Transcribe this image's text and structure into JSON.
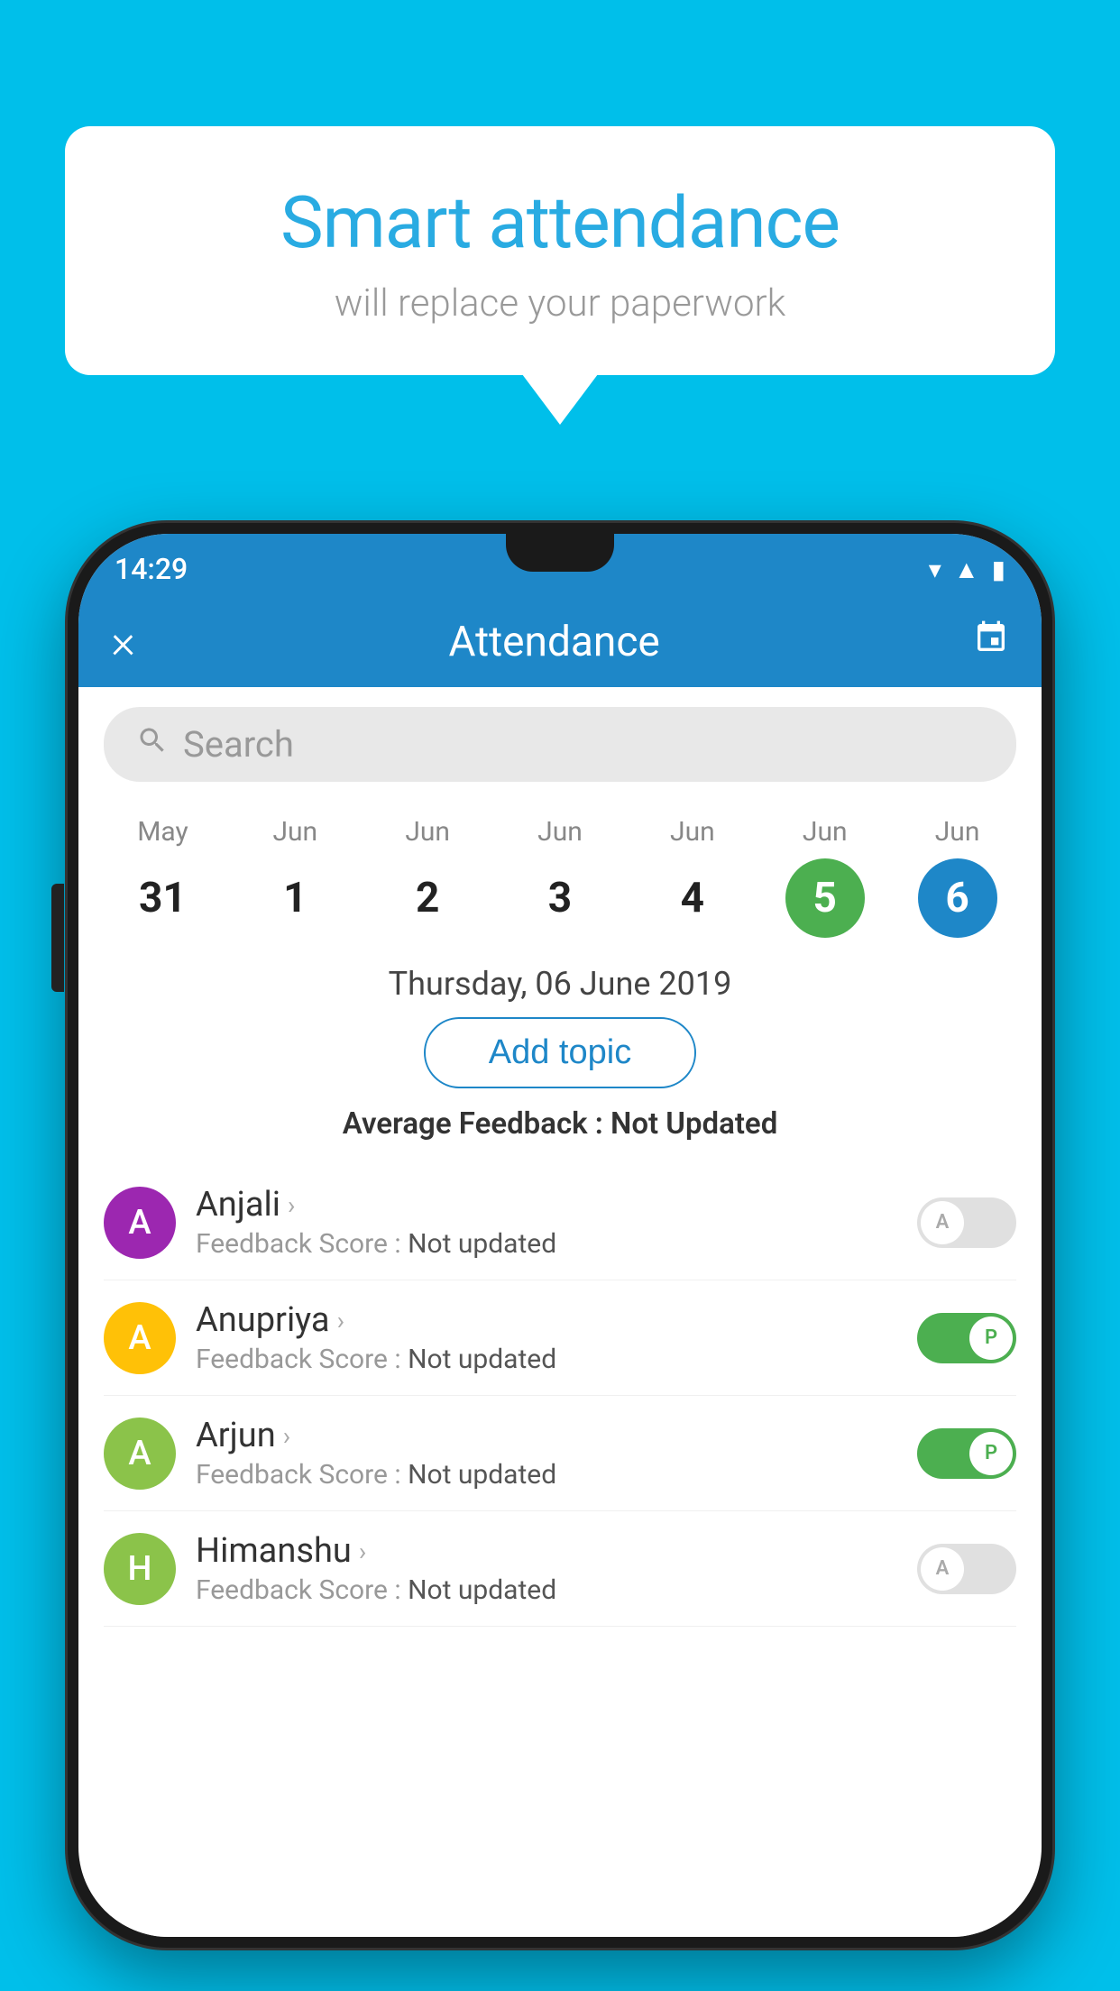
{
  "background_color": "#00BFEA",
  "bubble": {
    "title": "Smart attendance",
    "subtitle": "will replace your paperwork"
  },
  "status_bar": {
    "time": "14:29",
    "wifi": "▼",
    "signal": "▲",
    "battery": "▉"
  },
  "header": {
    "title": "Attendance",
    "close_icon": "×",
    "calendar_icon": "📅"
  },
  "search": {
    "placeholder": "Search"
  },
  "calendar": {
    "days": [
      {
        "month": "May",
        "num": "31",
        "state": "normal"
      },
      {
        "month": "Jun",
        "num": "1",
        "state": "normal"
      },
      {
        "month": "Jun",
        "num": "2",
        "state": "normal"
      },
      {
        "month": "Jun",
        "num": "3",
        "state": "normal"
      },
      {
        "month": "Jun",
        "num": "4",
        "state": "normal"
      },
      {
        "month": "Jun",
        "num": "5",
        "state": "today"
      },
      {
        "month": "Jun",
        "num": "6",
        "state": "selected"
      }
    ],
    "selected_date": "Thursday, 06 June 2019"
  },
  "add_topic_label": "Add topic",
  "avg_feedback": {
    "label": "Average Feedback : ",
    "value": "Not Updated"
  },
  "students": [
    {
      "name": "Anjali",
      "avatar_letter": "A",
      "avatar_color": "purple",
      "feedback_label": "Feedback Score : ",
      "feedback_value": "Not updated",
      "toggle_state": "off",
      "toggle_label": "A"
    },
    {
      "name": "Anupriya",
      "avatar_letter": "A",
      "avatar_color": "yellow",
      "feedback_label": "Feedback Score : ",
      "feedback_value": "Not updated",
      "toggle_state": "on",
      "toggle_label": "P"
    },
    {
      "name": "Arjun",
      "avatar_letter": "A",
      "avatar_color": "green",
      "feedback_label": "Feedback Score : ",
      "feedback_value": "Not updated",
      "toggle_state": "on",
      "toggle_label": "P"
    },
    {
      "name": "Himanshu",
      "avatar_letter": "H",
      "avatar_color": "light-green",
      "feedback_label": "Feedback Score : ",
      "feedback_value": "Not updated",
      "toggle_state": "off",
      "toggle_label": "A"
    }
  ]
}
